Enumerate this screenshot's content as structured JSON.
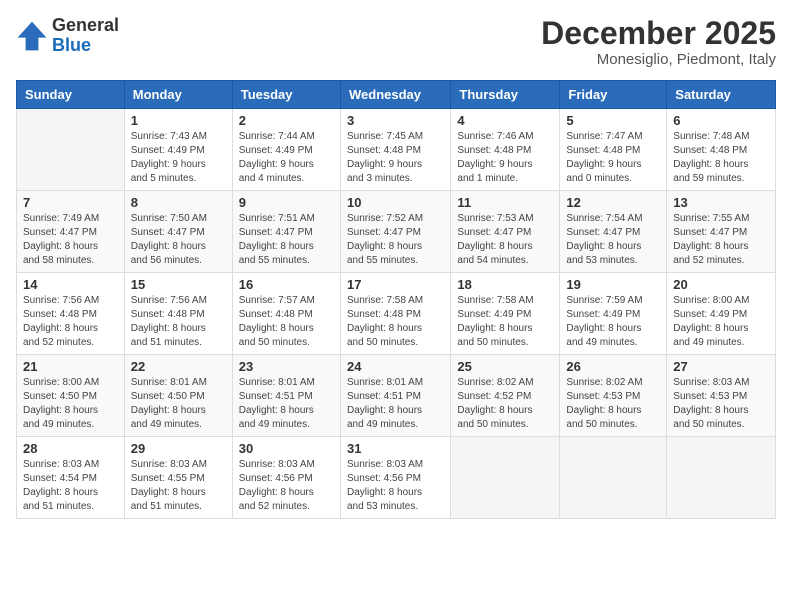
{
  "header": {
    "logo_general": "General",
    "logo_blue": "Blue",
    "month_title": "December 2025",
    "location": "Monesiglio, Piedmont, Italy"
  },
  "weekdays": [
    "Sunday",
    "Monday",
    "Tuesday",
    "Wednesday",
    "Thursday",
    "Friday",
    "Saturday"
  ],
  "weeks": [
    [
      {
        "day": "",
        "sunrise": "",
        "sunset": "",
        "daylight": ""
      },
      {
        "day": "1",
        "sunrise": "Sunrise: 7:43 AM",
        "sunset": "Sunset: 4:49 PM",
        "daylight": "Daylight: 9 hours and 5 minutes."
      },
      {
        "day": "2",
        "sunrise": "Sunrise: 7:44 AM",
        "sunset": "Sunset: 4:49 PM",
        "daylight": "Daylight: 9 hours and 4 minutes."
      },
      {
        "day": "3",
        "sunrise": "Sunrise: 7:45 AM",
        "sunset": "Sunset: 4:48 PM",
        "daylight": "Daylight: 9 hours and 3 minutes."
      },
      {
        "day": "4",
        "sunrise": "Sunrise: 7:46 AM",
        "sunset": "Sunset: 4:48 PM",
        "daylight": "Daylight: 9 hours and 1 minute."
      },
      {
        "day": "5",
        "sunrise": "Sunrise: 7:47 AM",
        "sunset": "Sunset: 4:48 PM",
        "daylight": "Daylight: 9 hours and 0 minutes."
      },
      {
        "day": "6",
        "sunrise": "Sunrise: 7:48 AM",
        "sunset": "Sunset: 4:48 PM",
        "daylight": "Daylight: 8 hours and 59 minutes."
      }
    ],
    [
      {
        "day": "7",
        "sunrise": "Sunrise: 7:49 AM",
        "sunset": "Sunset: 4:47 PM",
        "daylight": "Daylight: 8 hours and 58 minutes."
      },
      {
        "day": "8",
        "sunrise": "Sunrise: 7:50 AM",
        "sunset": "Sunset: 4:47 PM",
        "daylight": "Daylight: 8 hours and 56 minutes."
      },
      {
        "day": "9",
        "sunrise": "Sunrise: 7:51 AM",
        "sunset": "Sunset: 4:47 PM",
        "daylight": "Daylight: 8 hours and 55 minutes."
      },
      {
        "day": "10",
        "sunrise": "Sunrise: 7:52 AM",
        "sunset": "Sunset: 4:47 PM",
        "daylight": "Daylight: 8 hours and 55 minutes."
      },
      {
        "day": "11",
        "sunrise": "Sunrise: 7:53 AM",
        "sunset": "Sunset: 4:47 PM",
        "daylight": "Daylight: 8 hours and 54 minutes."
      },
      {
        "day": "12",
        "sunrise": "Sunrise: 7:54 AM",
        "sunset": "Sunset: 4:47 PM",
        "daylight": "Daylight: 8 hours and 53 minutes."
      },
      {
        "day": "13",
        "sunrise": "Sunrise: 7:55 AM",
        "sunset": "Sunset: 4:47 PM",
        "daylight": "Daylight: 8 hours and 52 minutes."
      }
    ],
    [
      {
        "day": "14",
        "sunrise": "Sunrise: 7:56 AM",
        "sunset": "Sunset: 4:48 PM",
        "daylight": "Daylight: 8 hours and 52 minutes."
      },
      {
        "day": "15",
        "sunrise": "Sunrise: 7:56 AM",
        "sunset": "Sunset: 4:48 PM",
        "daylight": "Daylight: 8 hours and 51 minutes."
      },
      {
        "day": "16",
        "sunrise": "Sunrise: 7:57 AM",
        "sunset": "Sunset: 4:48 PM",
        "daylight": "Daylight: 8 hours and 50 minutes."
      },
      {
        "day": "17",
        "sunrise": "Sunrise: 7:58 AM",
        "sunset": "Sunset: 4:48 PM",
        "daylight": "Daylight: 8 hours and 50 minutes."
      },
      {
        "day": "18",
        "sunrise": "Sunrise: 7:58 AM",
        "sunset": "Sunset: 4:49 PM",
        "daylight": "Daylight: 8 hours and 50 minutes."
      },
      {
        "day": "19",
        "sunrise": "Sunrise: 7:59 AM",
        "sunset": "Sunset: 4:49 PM",
        "daylight": "Daylight: 8 hours and 49 minutes."
      },
      {
        "day": "20",
        "sunrise": "Sunrise: 8:00 AM",
        "sunset": "Sunset: 4:49 PM",
        "daylight": "Daylight: 8 hours and 49 minutes."
      }
    ],
    [
      {
        "day": "21",
        "sunrise": "Sunrise: 8:00 AM",
        "sunset": "Sunset: 4:50 PM",
        "daylight": "Daylight: 8 hours and 49 minutes."
      },
      {
        "day": "22",
        "sunrise": "Sunrise: 8:01 AM",
        "sunset": "Sunset: 4:50 PM",
        "daylight": "Daylight: 8 hours and 49 minutes."
      },
      {
        "day": "23",
        "sunrise": "Sunrise: 8:01 AM",
        "sunset": "Sunset: 4:51 PM",
        "daylight": "Daylight: 8 hours and 49 minutes."
      },
      {
        "day": "24",
        "sunrise": "Sunrise: 8:01 AM",
        "sunset": "Sunset: 4:51 PM",
        "daylight": "Daylight: 8 hours and 49 minutes."
      },
      {
        "day": "25",
        "sunrise": "Sunrise: 8:02 AM",
        "sunset": "Sunset: 4:52 PM",
        "daylight": "Daylight: 8 hours and 50 minutes."
      },
      {
        "day": "26",
        "sunrise": "Sunrise: 8:02 AM",
        "sunset": "Sunset: 4:53 PM",
        "daylight": "Daylight: 8 hours and 50 minutes."
      },
      {
        "day": "27",
        "sunrise": "Sunrise: 8:03 AM",
        "sunset": "Sunset: 4:53 PM",
        "daylight": "Daylight: 8 hours and 50 minutes."
      }
    ],
    [
      {
        "day": "28",
        "sunrise": "Sunrise: 8:03 AM",
        "sunset": "Sunset: 4:54 PM",
        "daylight": "Daylight: 8 hours and 51 minutes."
      },
      {
        "day": "29",
        "sunrise": "Sunrise: 8:03 AM",
        "sunset": "Sunset: 4:55 PM",
        "daylight": "Daylight: 8 hours and 51 minutes."
      },
      {
        "day": "30",
        "sunrise": "Sunrise: 8:03 AM",
        "sunset": "Sunset: 4:56 PM",
        "daylight": "Daylight: 8 hours and 52 minutes."
      },
      {
        "day": "31",
        "sunrise": "Sunrise: 8:03 AM",
        "sunset": "Sunset: 4:56 PM",
        "daylight": "Daylight: 8 hours and 53 minutes."
      },
      {
        "day": "",
        "sunrise": "",
        "sunset": "",
        "daylight": ""
      },
      {
        "day": "",
        "sunrise": "",
        "sunset": "",
        "daylight": ""
      },
      {
        "day": "",
        "sunrise": "",
        "sunset": "",
        "daylight": ""
      }
    ]
  ]
}
